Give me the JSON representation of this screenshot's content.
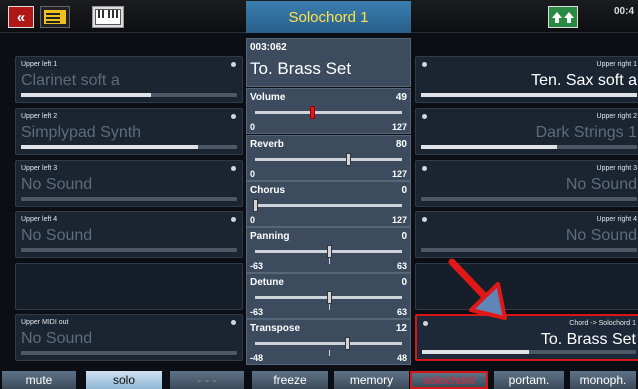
{
  "header": {
    "back_label": "«",
    "title": "Solochord 1",
    "clock": "00:4"
  },
  "left_slots": [
    {
      "label": "Upper left 1",
      "sound": "Clarinet soft  a",
      "level": 0.6
    },
    {
      "label": "Upper left 2",
      "sound": "Simplypad Synth",
      "level": 0.82
    },
    {
      "label": "Upper left 3",
      "sound": "No Sound",
      "level": 0
    },
    {
      "label": "Upper left 4",
      "sound": "No Sound",
      "level": 0
    },
    {
      "label": "Upper MIDI out",
      "sound": "No Sound",
      "level": 0
    }
  ],
  "right_slots": [
    {
      "label": "Upper right 1",
      "sound": "Ten. Sax soft  a",
      "level": 1.0
    },
    {
      "label": "Upper right 2",
      "sound": "Dark Strings 1",
      "level": 0.63
    },
    {
      "label": "Upper right 3",
      "sound": "No Sound",
      "level": 0
    },
    {
      "label": "Upper right 4",
      "sound": "No Sound",
      "level": 0
    },
    {
      "label": "Chord ->    Solochord 1",
      "sound": "To. Brass Set",
      "level": 0.5
    }
  ],
  "preset": {
    "number": "003:062",
    "name": "To. Brass Set"
  },
  "params": [
    {
      "name": "Volume",
      "value": "49",
      "min": "0",
      "max": "127",
      "pos": 0.39
    },
    {
      "name": "Reverb",
      "value": "80",
      "min": "0",
      "max": "127",
      "pos": 0.63
    },
    {
      "name": "Chorus",
      "value": "0",
      "min": "0",
      "max": "127",
      "pos": 0.0
    },
    {
      "name": "Panning",
      "value": "0",
      "min": "-63",
      "max": "63",
      "pos": 0.5
    },
    {
      "name": "Detune",
      "value": "0",
      "min": "-63",
      "max": "63",
      "pos": 0.5
    },
    {
      "name": "Transpose",
      "value": "12",
      "min": "-48",
      "max": "48",
      "pos": 0.625
    }
  ],
  "bottom": {
    "mute": "mute",
    "solo": "solo",
    "blank": "- - -",
    "freeze": "freeze",
    "memory": "memory",
    "solochord": "solochord",
    "portam": "portam.",
    "monoph": "monoph."
  },
  "colors": {
    "accent": "#d7161a",
    "title_text": "#ffe14a",
    "panel": "#3c4c5e"
  }
}
